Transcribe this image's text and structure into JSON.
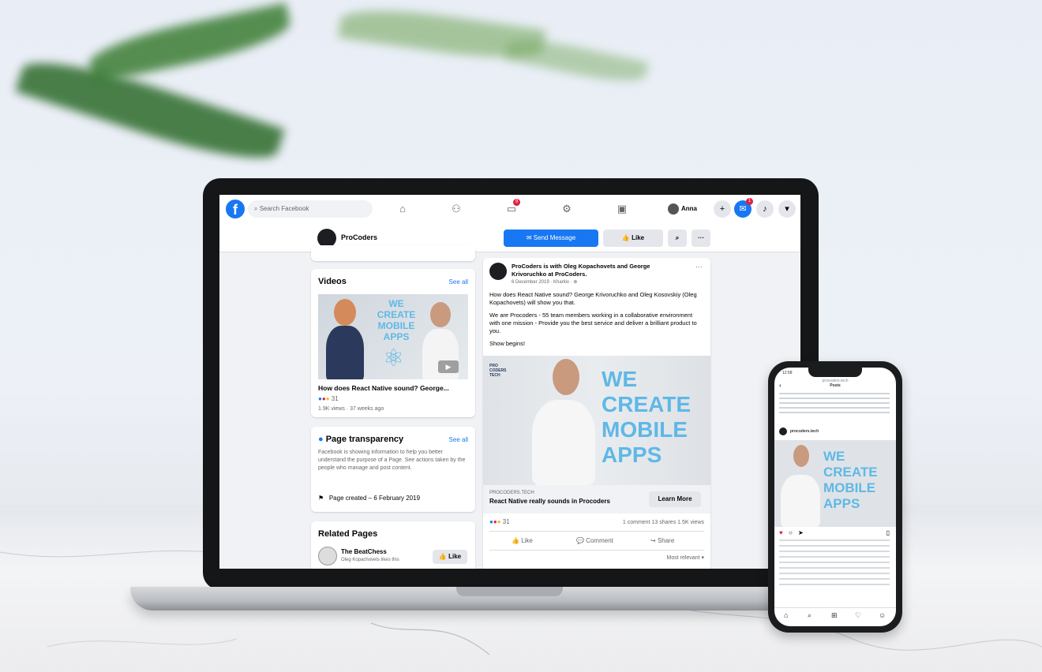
{
  "topnav": {
    "logo_letter": "f",
    "search_placeholder": "Search Facebook",
    "icons": [
      "home-icon",
      "friends-icon",
      "watch-icon",
      "groups-icon",
      "gaming-icon"
    ],
    "watch_badge": "9",
    "profile_name": "Anna",
    "messenger_badge": "1",
    "right_icons": [
      "plus-icon",
      "messenger-icon",
      "bell-icon",
      "caret-icon"
    ]
  },
  "pagebar": {
    "page_name": "ProCoders",
    "send_message": "Send Message",
    "like": "Like",
    "search_glyph": "⌕",
    "more_glyph": "···"
  },
  "videos_card": {
    "title": "Videos",
    "see_all": "See all",
    "thumb_text": [
      "WE",
      "CREATE",
      "MOBILE",
      "APPS"
    ],
    "video_title": "How does React Native sound? George...",
    "reaction_count": "31",
    "meta": "1.9K views · 37 weeks ago"
  },
  "transparency_card": {
    "title": "Page transparency",
    "see_all": "See all",
    "body": "Facebook is showing information to help you better understand the purpose of a Page. See actions taken by the people who manage and post content.",
    "created": "Page created – 6 February 2019"
  },
  "related_card": {
    "title": "Related Pages",
    "page_name": "The BeatChess",
    "page_sub": "Oleg Kopachovets likes this",
    "like": "Like"
  },
  "post": {
    "author_line_1": "ProCoders is with Oleg Kopachovets and George",
    "author_line_2": "Krivoruchko at ProCoders.",
    "date": "6 December 2019 · Kharkiv · ⊕",
    "more": "···",
    "para1": "How does React Native sound? George Krivoruchko and Oleg Kosovskiy (Oleg Kopachovets) will show you that.",
    "para2": "We are Procoders - 55 team members working in a collaborative environment with one mission - Provide you the best service and deliver a brilliant product to you.",
    "para3": "Show begins!",
    "image_text": [
      "WE",
      "CREATE",
      "MOBILE",
      "APPS"
    ],
    "corner_logo": "PRO CODERS TECH",
    "link_domain": "PROCODERS.TECH",
    "link_title": "React Native really sounds in Procoders",
    "learn_more": "Learn More",
    "reaction_count": "31",
    "stats": "1 comment  13 shares  1.5K views",
    "actions": [
      "Like",
      "Comment",
      "Share"
    ],
    "sort": "Most relevant ▾"
  },
  "phone": {
    "time": "12:58",
    "header_sub": "procoders.tech",
    "header_title": "Posts",
    "image_text": [
      "WE",
      "CREATE",
      "MOBILE",
      "APPS"
    ],
    "handle": "procoders.tech"
  }
}
